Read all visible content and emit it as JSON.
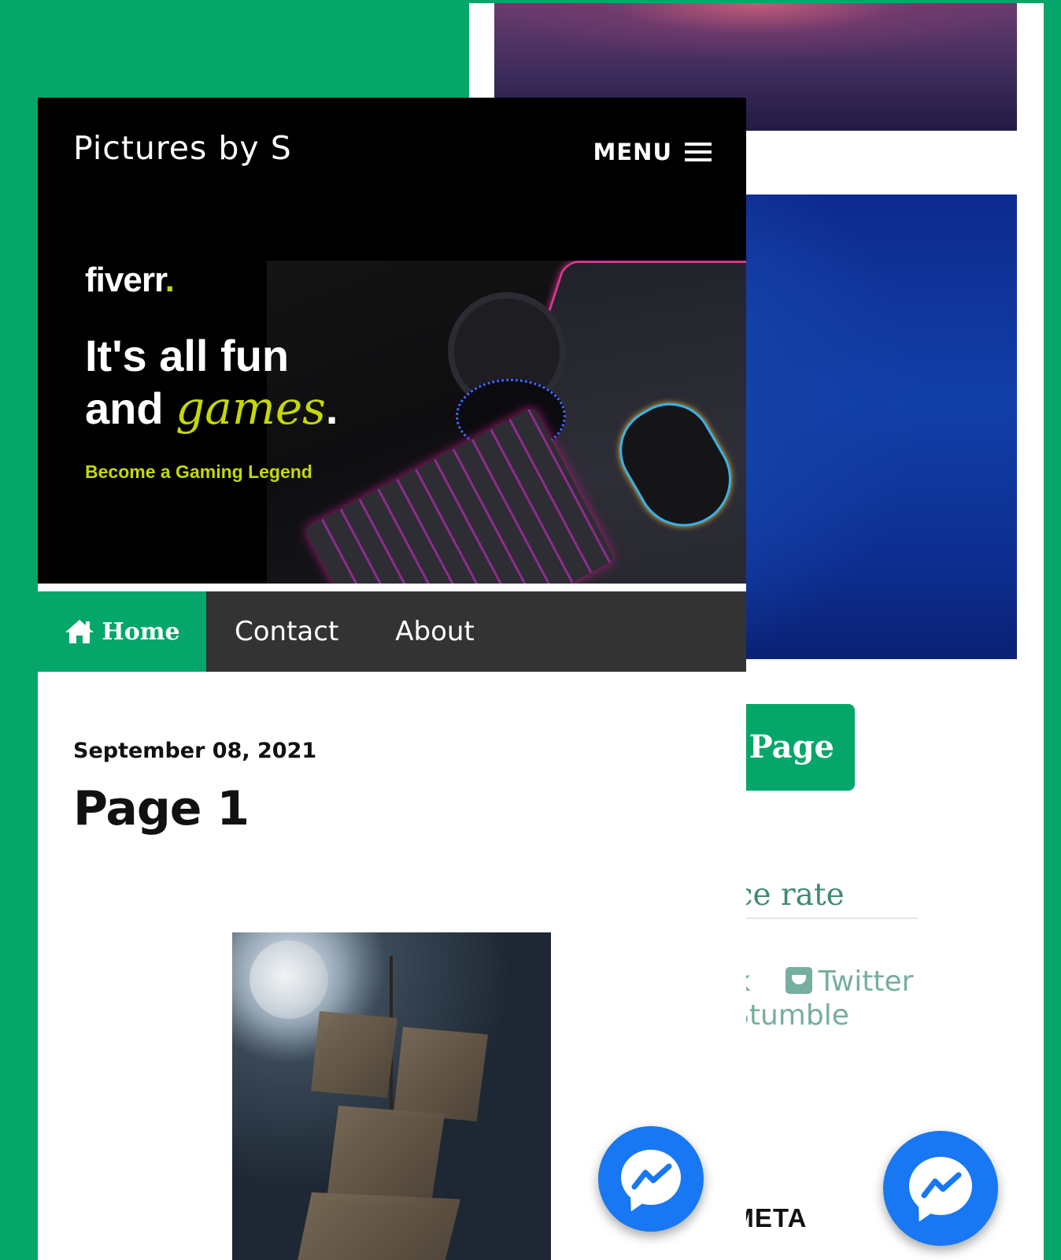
{
  "back_window": {
    "page_button_label": "t Page",
    "bounce_rate_text": "bounce rate",
    "share_row_1_left": "book",
    "share_row_1_twitter": "Twitter",
    "share_row_2": "Stumble",
    "post_meta_heading": "ST META",
    "images": {
      "top": "purple-gradient-image",
      "middle": "blue-abstract-image"
    }
  },
  "header": {
    "site_title": "Pictures by S",
    "menu_label": "MENU"
  },
  "hero": {
    "logo": "fiverr",
    "headline_line1": "It's all fun",
    "headline_line2_prefix": "and ",
    "headline_line2_accent": "games",
    "headline_period": ".",
    "subline": "Become a Gaming Legend",
    "accent_color": "#c5d805"
  },
  "nav": {
    "home": "Home",
    "items": [
      "Contact",
      "About"
    ]
  },
  "post": {
    "date": "September 08, 2021",
    "title": "Page 1",
    "image": "ship-under-full-moon"
  },
  "colors": {
    "page_background": "#04a66a",
    "nav_background": "#333333",
    "nav_active": "#04a66a",
    "messenger_blue": "#1877f2"
  }
}
